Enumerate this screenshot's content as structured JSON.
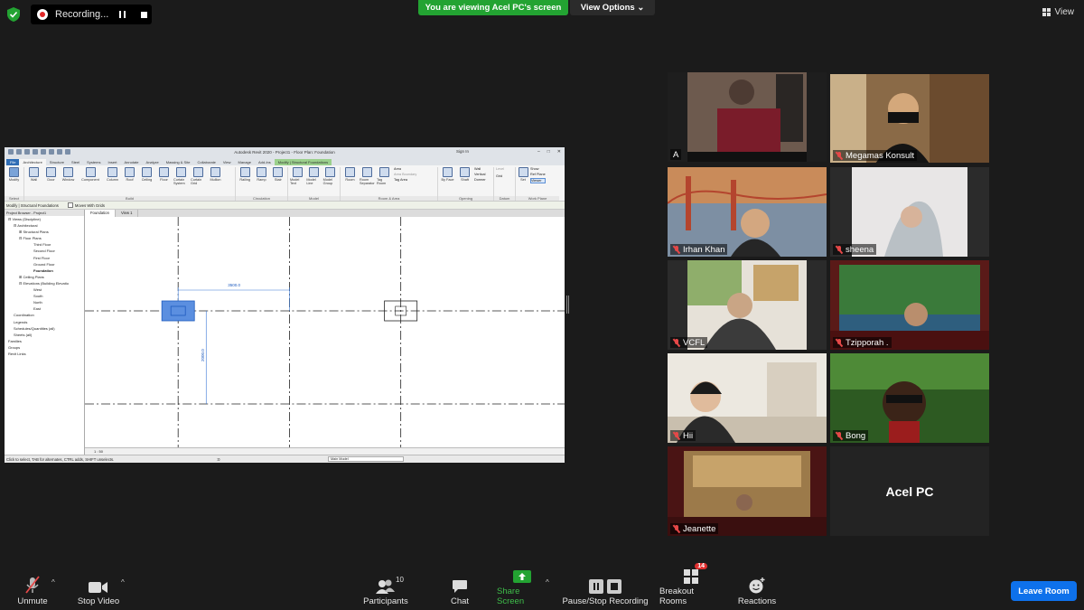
{
  "top": {
    "recording_label": "Recording...",
    "viewing_banner": "You are viewing Acel PC's screen",
    "view_options": "View Options ⌄",
    "view_label": "View"
  },
  "revit": {
    "title": "Autodesk Revit 2020 - Project1 - Floor Plan: Foundation",
    "sign_in": "Sign In",
    "tabs": [
      "File",
      "Architecture",
      "Structure",
      "Steel",
      "Systems",
      "Insert",
      "Annotate",
      "Analyze",
      "Massing & Site",
      "Collaborate",
      "View",
      "Manage",
      "Add-Ins",
      "Modify | Structural Foundations"
    ],
    "groups": {
      "select": "Select",
      "build": "Build",
      "circulation": "Circulation",
      "model": "Model",
      "room_area": "Room & Area",
      "opening": "Opening",
      "datum": "Datum",
      "work_plane": "Work Plane"
    },
    "buttons": {
      "modify": "Modify",
      "wall": "Wall",
      "door": "Door",
      "window": "Window",
      "component": "Component",
      "column": "Column",
      "roof": "Roof",
      "ceiling": "Ceiling",
      "floor": "Floor",
      "curtain_system": "Curtain System",
      "curtain_grid": "Curtain Grid",
      "mullion": "Mullion",
      "railing": "Railing",
      "ramp": "Ramp",
      "stair": "Stair",
      "model_text": "Model Text",
      "model_line": "Model Line",
      "model_group": "Model Group",
      "room": "Room",
      "room_separator": "Room Separator",
      "tag_room": "Tag Room",
      "area": "Area",
      "area_boundary": "Area Boundary",
      "tag_area": "Tag Area",
      "by_face": "By Face",
      "shaft": "Shaft",
      "wall_op": "Wall",
      "vertical": "Vertical",
      "dormer": "Dormer",
      "level": "Level",
      "grid": "Grid",
      "set": "Set",
      "show": "Show",
      "ref_plane": "Ref  Plane",
      "viewer": "Viewer"
    },
    "options_bar": {
      "context": "Modify | Structural Foundations",
      "moves_with_grids": "Moves With Grids"
    },
    "browser": {
      "header": "Project Browser - Project1",
      "items": [
        "⊟ Views (Discipline)",
        "⊟ Architectural",
        "⊞ Structural Plans",
        "⊟ Floor Plans",
        "Third Floor",
        "Second Floor",
        "First Floor",
        "Ground Floor",
        "Foundation",
        "⊞ Ceiling Plans",
        "⊟ Elevations (Building Elevatio",
        "West",
        "South",
        "North",
        "East",
        "Coordination",
        "Legends",
        "Schedules/Quantities (all)",
        "Sheets (all)",
        "Families",
        "Groups",
        "Revit Links"
      ]
    },
    "view_tabs": [
      "Foundation",
      "View 1"
    ],
    "dim_horizontal": "3500.0",
    "dim_vertical": "2000.0",
    "scale": "1 : 50",
    "status_text": "Click to select, TAB for alternates, CTRL adds, SHIFT unselects.",
    "model_selector": "Main Model",
    "zero": ":0"
  },
  "participants": [
    {
      "name": "A",
      "muted": false
    },
    {
      "name": "Megamas Konsult",
      "muted": true
    },
    {
      "name": "Irhan Khan",
      "muted": true
    },
    {
      "name": "sheena",
      "muted": true
    },
    {
      "name": "VCFL",
      "muted": true
    },
    {
      "name": "Tzipporah .",
      "muted": true
    },
    {
      "name": "Hii",
      "muted": true
    },
    {
      "name": "Bong",
      "muted": true
    },
    {
      "name": "Jeanette",
      "muted": true
    },
    {
      "name": "Acel PC",
      "muted": false
    }
  ],
  "toolbar": {
    "unmute": "Unmute",
    "stop_video": "Stop Video",
    "participants": "Participants",
    "participants_count": "10",
    "chat": "Chat",
    "share_screen": "Share Screen",
    "pause_stop_recording": "Pause/Stop Recording",
    "breakout_rooms": "Breakout Rooms",
    "breakout_badge": "14",
    "reactions": "Reactions",
    "leave_room": "Leave Room"
  },
  "colors": {
    "share_green": "#23a332",
    "active_speaker": "#c5e44f",
    "leave_blue": "#0e71eb",
    "muted_red": "#e54848"
  }
}
